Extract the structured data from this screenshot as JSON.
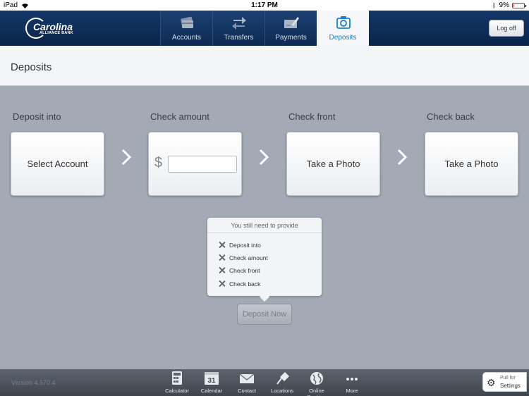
{
  "status": {
    "device": "iPad",
    "time": "1:17 PM",
    "battery": "9%",
    "battery_level": 0.09
  },
  "brand": {
    "name": "Carolina",
    "tagline": "ALLIANCE BANK"
  },
  "nav": {
    "tabs": [
      {
        "label": "Accounts",
        "icon": "cards-icon"
      },
      {
        "label": "Transfers",
        "icon": "transfer-arrows-icon"
      },
      {
        "label": "Payments",
        "icon": "check-pen-icon"
      },
      {
        "label": "Deposits",
        "icon": "camera-icon",
        "active": true
      }
    ],
    "logoff_label": "Log off"
  },
  "page": {
    "title": "Deposits"
  },
  "steps": [
    {
      "label": "Deposit into",
      "action": "Select Account"
    },
    {
      "label": "Check amount",
      "currency": "$",
      "amount": ""
    },
    {
      "label": "Check front",
      "action": "Take a Photo"
    },
    {
      "label": "Check back",
      "action": "Take a Photo"
    }
  ],
  "tooltip": {
    "header": "You still need to provide",
    "items": [
      "Deposit into",
      "Check amount",
      "Check front",
      "Check back"
    ]
  },
  "deposit_button": "Deposit Now",
  "footer": {
    "version": "Version 4.570.4",
    "tools": [
      {
        "label": "Calculator",
        "icon": "calculator-icon"
      },
      {
        "label": "Calendar",
        "icon": "calendar-icon",
        "day": "31"
      },
      {
        "label": "Contact",
        "icon": "envelope-icon"
      },
      {
        "label": "Locations",
        "icon": "pin-icon"
      },
      {
        "label": "Online Banking",
        "icon": "globe-icon"
      },
      {
        "label": "More",
        "icon": "more-dots-icon"
      }
    ],
    "settings": {
      "pull_label": "Pull for",
      "label": "Settings"
    }
  },
  "colors": {
    "nav_bg": "#0d2a52",
    "active_tab_text": "#1a7fc7",
    "canvas": "#a3aab5"
  }
}
